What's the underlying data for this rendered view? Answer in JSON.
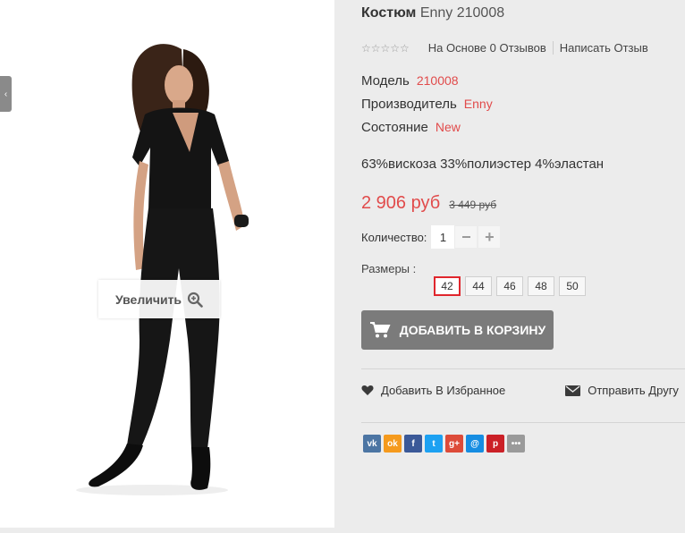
{
  "gallery": {
    "zoom_label": "Увеличить",
    "prev_icon": "chevron-left-icon"
  },
  "product": {
    "title_name": "Костюм",
    "title_rest": "Enny 210008",
    "rating": {
      "stars_filled": 0,
      "stars_total": 5,
      "reviews_text": "На Основе 0 Отзывов",
      "write_review": "Написать Отзыв"
    },
    "specs": [
      {
        "label": "Модель",
        "value": "210008"
      },
      {
        "label": "Производитель",
        "value": "Enny"
      },
      {
        "label": "Состояние",
        "value": "New"
      }
    ],
    "composition": "63%вискоза 33%полиэстер 4%эластан",
    "price_new": "2 906 руб",
    "price_old": "3 449 руб",
    "quantity_label": "Количество:",
    "quantity_value": "1",
    "qty_minus": "−",
    "qty_plus": "+",
    "sizes_label": "Размеры :",
    "sizes": [
      "42",
      "44",
      "46",
      "48",
      "50"
    ],
    "selected_size": "42",
    "add_to_cart": "Добавить в корзину",
    "wishlist": "Добавить В Избранное",
    "send_friend": "Отправить Другу"
  },
  "social": [
    {
      "name": "vk",
      "glyph": "vk",
      "color": "#4c75a3"
    },
    {
      "name": "odnoklassniki",
      "glyph": "ok",
      "color": "#f59a1d"
    },
    {
      "name": "facebook",
      "glyph": "f",
      "color": "#3b5998"
    },
    {
      "name": "twitter",
      "glyph": "t",
      "color": "#1da1f2"
    },
    {
      "name": "google-plus",
      "glyph": "g+",
      "color": "#dd4b39"
    },
    {
      "name": "mail",
      "glyph": "@",
      "color": "#168de2"
    },
    {
      "name": "pinterest",
      "glyph": "p",
      "color": "#cb2027"
    },
    {
      "name": "more",
      "glyph": "•••",
      "color": "#9a9a9a"
    }
  ],
  "colors": {
    "accent": "#e14b4b",
    "button": "#7b7b7b",
    "selected_size_border": "#e0262d"
  }
}
